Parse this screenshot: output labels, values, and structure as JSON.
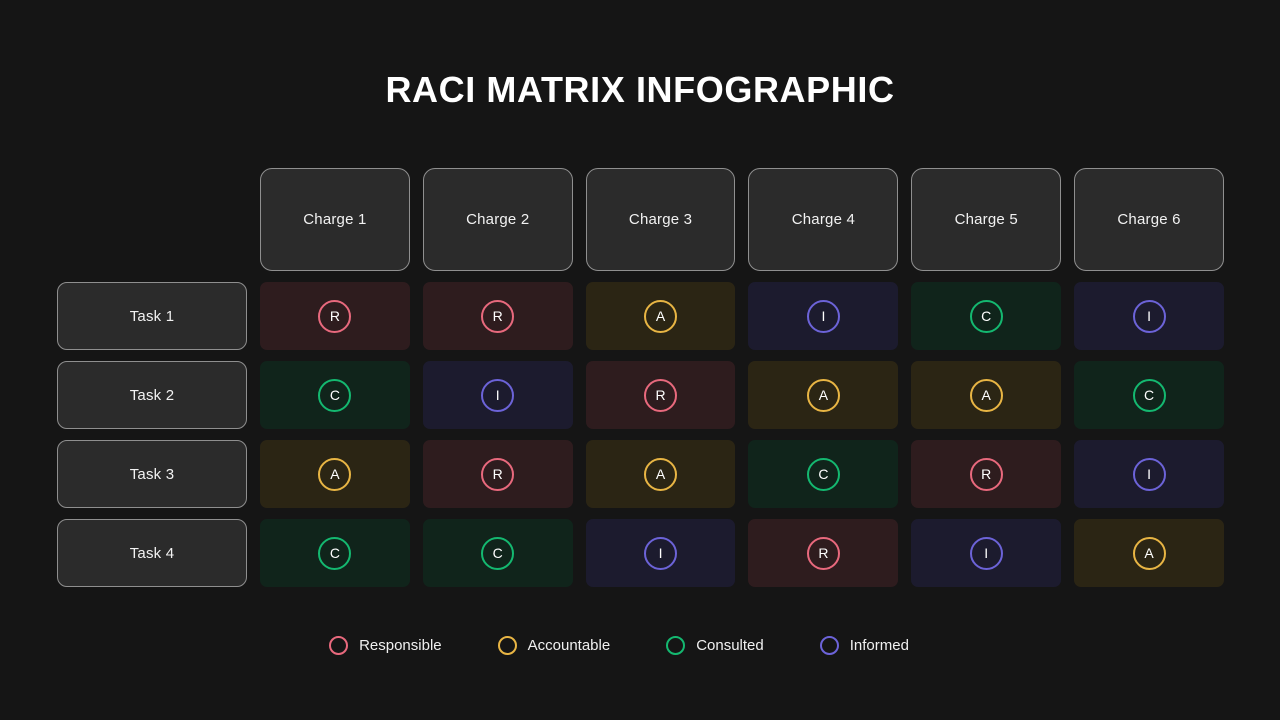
{
  "title": "RACI MATRIX INFOGRAPHIC",
  "background_color": "#151515",
  "columns": [
    {
      "label": "Charge 1"
    },
    {
      "label": "Charge 2"
    },
    {
      "label": "Charge 3"
    },
    {
      "label": "Charge 4"
    },
    {
      "label": "Charge 5"
    },
    {
      "label": "Charge 6"
    }
  ],
  "rows": [
    {
      "label": "Task 1",
      "cells": [
        "R",
        "R",
        "A",
        "I",
        "C",
        "I"
      ]
    },
    {
      "label": "Task 2",
      "cells": [
        "C",
        "I",
        "R",
        "A",
        "A",
        "C"
      ]
    },
    {
      "label": "Task 3",
      "cells": [
        "A",
        "R",
        "A",
        "C",
        "R",
        "I"
      ]
    },
    {
      "label": "Task 4",
      "cells": [
        "C",
        "C",
        "I",
        "R",
        "I",
        "A"
      ]
    }
  ],
  "roles": {
    "R": {
      "code": "R",
      "name": "Responsible",
      "ring_color": "#e8697d",
      "cell_color": "#2e1c1e"
    },
    "A": {
      "code": "A",
      "name": "Accountable",
      "ring_color": "#e8b544",
      "cell_color": "#2b2514"
    },
    "C": {
      "code": "C",
      "name": "Consulted",
      "ring_color": "#14b870",
      "cell_color": "#10241b"
    },
    "I": {
      "code": "I",
      "name": "Informed",
      "ring_color": "#6c63d8",
      "cell_color": "#1c1b2e"
    }
  },
  "legend": [
    {
      "code": "R",
      "label": "Responsible",
      "ring_color": "#e8697d"
    },
    {
      "code": "A",
      "label": "Accountable",
      "ring_color": "#e8b544"
    },
    {
      "code": "C",
      "label": "Consulted",
      "ring_color": "#14b870"
    },
    {
      "code": "I",
      "label": "Informed",
      "ring_color": "#6c63d8"
    }
  ]
}
